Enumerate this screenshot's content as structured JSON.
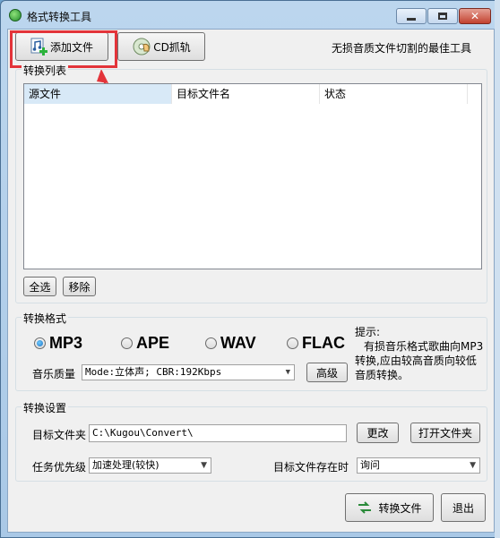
{
  "window": {
    "title": "格式转换工具",
    "minimize_icon": "minimize-icon",
    "maximize_icon": "maximize-icon",
    "close_icon": "close-icon"
  },
  "toolbar": {
    "add_file_label": "添加文件",
    "cd_rip_label": "CD抓轨",
    "slogan": "无损音质文件切割的最佳工具"
  },
  "list": {
    "group_label": "转换列表",
    "columns": [
      "源文件",
      "目标文件名",
      "状态"
    ],
    "select_all_label": "全选",
    "remove_label": "移除"
  },
  "format": {
    "group_label": "转换格式",
    "options": [
      "MP3",
      "APE",
      "WAV",
      "FLAC"
    ],
    "selected": "MP3",
    "quality_label": "音乐质量",
    "quality_value": "Mode:立体声; CBR:192Kbps",
    "advanced_label": "高级",
    "tip_title": "提示:",
    "tip_line1": "有损音乐格式歌曲向MP3",
    "tip_line2": "转换,应由较高音质向较低",
    "tip_line3": "音质转换。"
  },
  "settings": {
    "group_label": "转换设置",
    "target_folder_label": "目标文件夹",
    "target_folder_value": "C:\\Kugou\\Convert\\",
    "change_label": "更改",
    "open_folder_label": "打开文件夹",
    "priority_label": "任务优先级",
    "priority_value": "加速处理(较快)",
    "exists_label": "目标文件存在时",
    "exists_value": "询问"
  },
  "footer": {
    "convert_label": "转换文件",
    "exit_label": "退出"
  },
  "colors": {
    "highlight": "#e3343a",
    "arrow": "#e3343a",
    "radio_selected": "#1c6fc1"
  }
}
